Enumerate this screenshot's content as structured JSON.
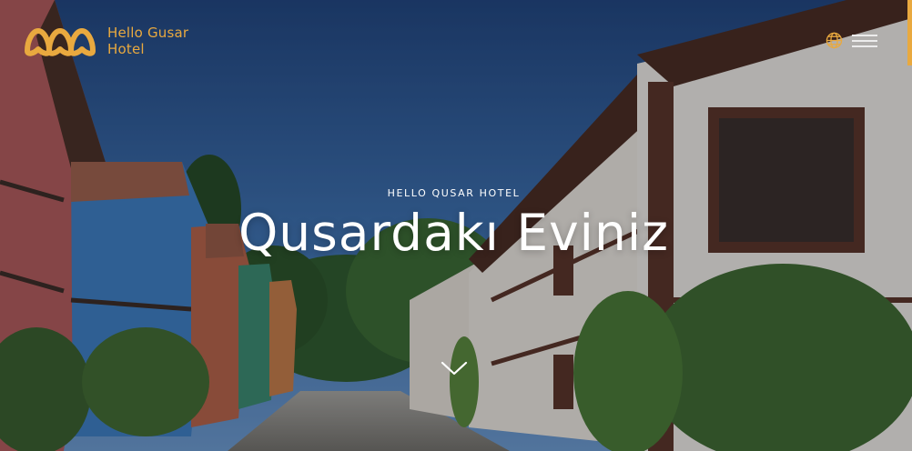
{
  "header": {
    "brand_line1": "Hello Gusar",
    "brand_line2": "Hotel"
  },
  "hero": {
    "eyebrow": "HELLO QUSAR HOTEL",
    "headline": "Qusardakı Eviniz"
  },
  "icons": {
    "logo": "hello-logo-mark",
    "language": "globe-icon",
    "menu": "hamburger-menu-icon",
    "scroll": "chevron-down-icon"
  },
  "colors": {
    "accent": "#e9a93f",
    "text": "#ffffff"
  }
}
